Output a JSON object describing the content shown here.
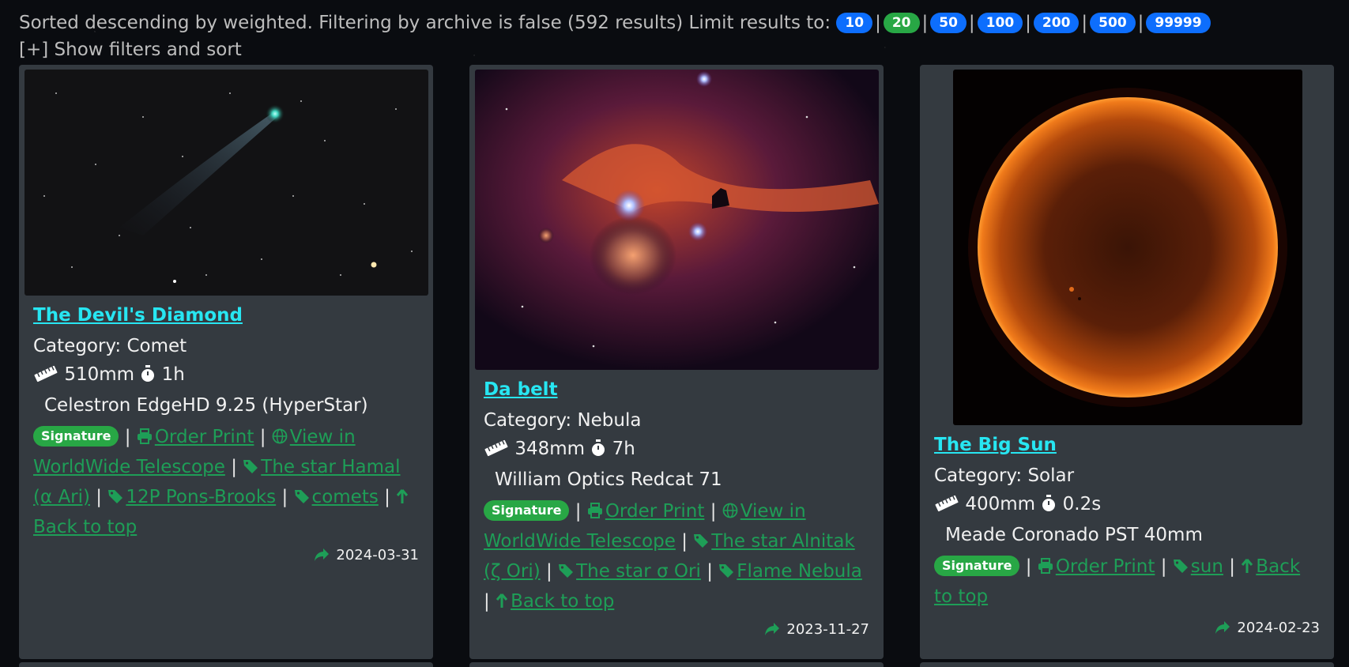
{
  "header": {
    "status_text": "Sorted descending by weighted. Filtering by archive is false (592 results) Limit results to:",
    "limits": [
      "10",
      "20",
      "50",
      "100",
      "200",
      "500",
      "99999"
    ],
    "active_limit": "20",
    "separator": "|",
    "toggle_label": "[+] Show filters and sort"
  },
  "cards": [
    {
      "title": "The Devil's Diamond",
      "category": "Category: Comet",
      "focal": "510mm",
      "exposure": "1h",
      "scope": "Celestron EdgeHD 9.25 (HyperStar)",
      "badge": "Signature",
      "order": "Order Print",
      "wwt": "View in WorldWide Telescope",
      "tags": [
        "The star Hamal (α Ari)",
        "12P Pons-Brooks",
        "comets"
      ],
      "back": "Back to top",
      "date": "2024-03-31"
    },
    {
      "title": "Da belt",
      "category": "Category: Nebula",
      "focal": "348mm",
      "exposure": "7h",
      "scope": "William Optics Redcat 71",
      "badge": "Signature",
      "order": "Order Print",
      "wwt": "View in WorldWide Telescope",
      "tags": [
        "The star Alnitak (ζ Ori)",
        "The star σ Ori",
        "Flame Nebula"
      ],
      "back": "Back to top",
      "date": "2023-11-27"
    },
    {
      "title": "The Big Sun",
      "category": "Category: Solar",
      "focal": "400mm",
      "exposure": "0.2s",
      "scope": "Meade Coronado PST 40mm",
      "badge": "Signature",
      "order": "Order Print",
      "tags": [
        "sun"
      ],
      "back": "Back to top",
      "date": "2024-02-23"
    }
  ],
  "colors": {
    "link_green": "#1e9e57",
    "title_cyan": "#27e6f2",
    "pill_blue": "#0d6efd",
    "pill_green": "#28a745",
    "card_bg": "#343a40"
  }
}
